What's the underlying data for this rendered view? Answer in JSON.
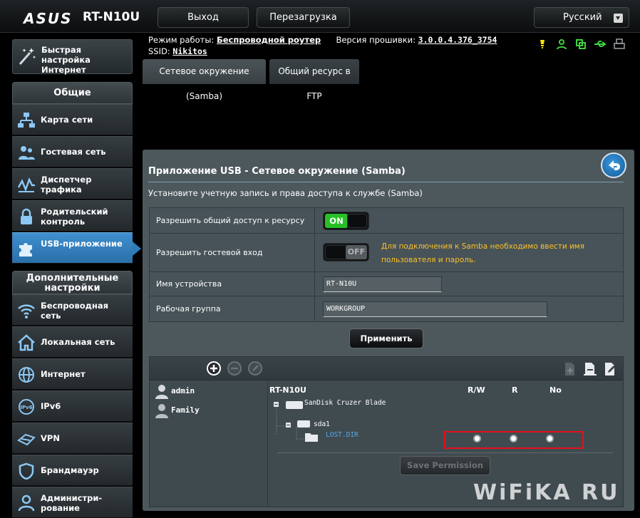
{
  "header": {
    "brand": "ASUS",
    "model": "RT-N10U",
    "logout_label": "Выход",
    "reboot_label": "Перезагрузка",
    "language": "Русский"
  },
  "status": {
    "mode_label": "Режим работы:",
    "mode_value": "Беспроводной роутер",
    "firmware_label": "Версия прошивки:",
    "firmware_value": "3.0.0.4.376_3754",
    "ssid_label": "SSID:",
    "ssid_value": "Nikitos",
    "icons": [
      "lightbulb-icon",
      "user-icon",
      "copy-icon",
      "usb-icon",
      "printer-icon"
    ]
  },
  "tabs": [
    {
      "label": "Сетевое окружение (Samba)",
      "active": true
    },
    {
      "label": "Общий ресурс в FTP",
      "active": false
    }
  ],
  "sidebar": {
    "quick_setup": "Быстрая настройка Интернет",
    "general_title": "Общие",
    "general_items": [
      {
        "label": "Карта сети",
        "icon": "network-map-icon"
      },
      {
        "label": "Гостевая сеть",
        "icon": "guest-network-icon"
      },
      {
        "label": "Диспетчер трафика",
        "icon": "traffic-manager-icon"
      },
      {
        "label": "Родительский контроль",
        "icon": "parental-lock-icon"
      },
      {
        "label": "USB-приложение",
        "icon": "puzzle-icon",
        "active": true
      }
    ],
    "advanced_title": "Дополнительные настройки",
    "advanced_items": [
      {
        "label": "Беспроводная сеть",
        "icon": "wifi-icon"
      },
      {
        "label": "Локальная сеть",
        "icon": "home-icon"
      },
      {
        "label": "Интернет",
        "icon": "globe-icon"
      },
      {
        "label": "IPv6",
        "icon": "ipv6-icon"
      },
      {
        "label": "VPN",
        "icon": "vpn-icon"
      },
      {
        "label": "Брандмауэр",
        "icon": "firewall-icon"
      },
      {
        "label": "Администри-рование",
        "icon": "admin-icon"
      }
    ]
  },
  "panel": {
    "title": "Приложение USB - Сетевое окружение (Samba)",
    "description": "Установите учетную запись и права доступа к службе (Samba)",
    "rows": [
      {
        "label": "Разрешить общий доступ к ресурсу",
        "toggle": "ON"
      },
      {
        "label": "Разрешить гостевой вход",
        "toggle": "OFF",
        "note": "Для подключения к Samba необходимо ввести имя пользователя и пароль."
      },
      {
        "label": "Имя устройства",
        "value": "RT-N10U"
      },
      {
        "label": "Рабочая группа",
        "value": "WORKGROUP"
      }
    ],
    "apply_label": "Применить"
  },
  "share": {
    "users": [
      "admin",
      "Family"
    ],
    "device": "RT-N10U",
    "columns": [
      "R/W",
      "R",
      "No"
    ],
    "disk": "SanDisk Cruzer Blade",
    "partition": "sda1",
    "folder": "LOST.DIR",
    "save_label": "Save Permission"
  },
  "watermark": "WiFiKA RU",
  "colors": {
    "accent": "#2f7bb8",
    "toggle_on": "#27c027",
    "warning": "#fbc02d",
    "highlight": "#e5101a"
  }
}
